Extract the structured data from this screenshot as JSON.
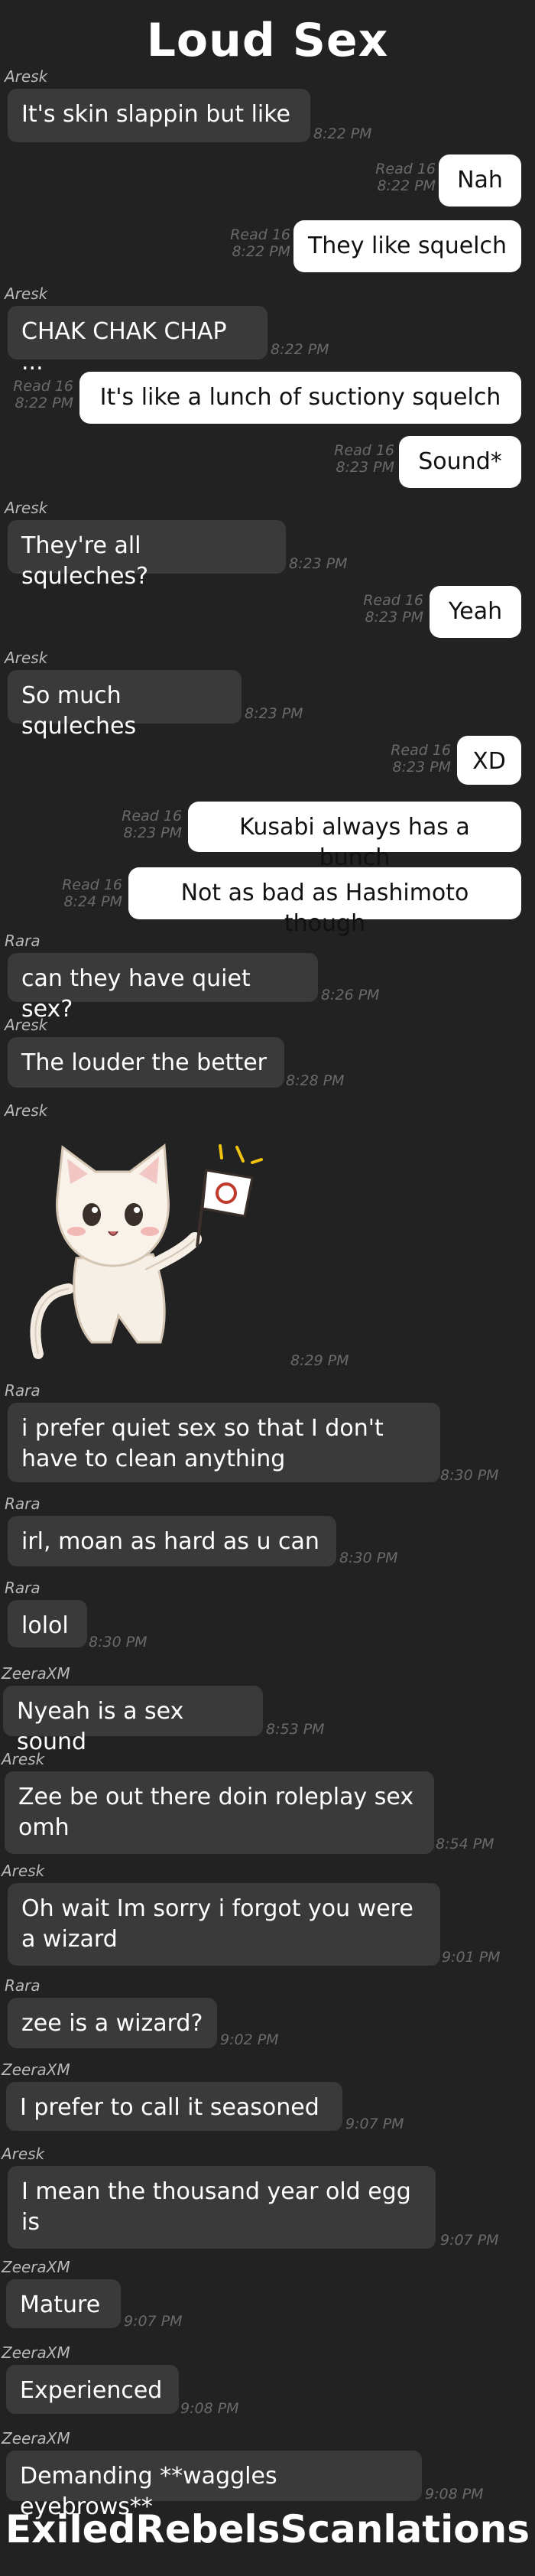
{
  "header": {
    "title": "Loud Sex"
  },
  "footer": {
    "credit": "ExiledRebelsScanlations"
  },
  "read_label": "Read 16",
  "messages": [
    {
      "sender": "Aresk",
      "text": "It's skin slappin but like",
      "time": "8:22 PM"
    },
    {
      "text": "Nah",
      "time": "8:22 PM"
    },
    {
      "text": "They like squelch",
      "time": "8:22 PM"
    },
    {
      "sender": "Aresk",
      "text": "CHAK CHAK CHAP ...",
      "time": "8:22 PM"
    },
    {
      "text": "It's like a lunch of suctiony squelch",
      "time": "8:22 PM"
    },
    {
      "text": "Sound*",
      "time": "8:23 PM"
    },
    {
      "sender": "Aresk",
      "text": "They're all squleches?",
      "time": "8:23 PM"
    },
    {
      "text": "Yeah",
      "time": "8:23 PM"
    },
    {
      "sender": "Aresk",
      "text": "So much squleches",
      "time": "8:23 PM"
    },
    {
      "text": "XD",
      "time": "8:23 PM"
    },
    {
      "text": "Kusabi always has a bunch",
      "time": "8:23 PM"
    },
    {
      "text": "Not as bad as Hashimoto though",
      "time": "8:24 PM"
    },
    {
      "sender": "Rara",
      "text": "can they have quiet sex?",
      "time": "8:26 PM"
    },
    {
      "sender": "Aresk",
      "text": "The louder the better",
      "time": "8:28 PM"
    },
    {
      "sender": "Aresk",
      "sticker": "cat-holding-flag-sticker",
      "time": "8:29 PM"
    },
    {
      "sender": "Rara",
      "text": "i prefer quiet sex so that I don't have to clean anything",
      "time": "8:30 PM"
    },
    {
      "sender": "Rara",
      "text": "irl, moan as hard as u can",
      "time": "8:30 PM"
    },
    {
      "sender": "Rara",
      "text": "lolol",
      "time": "8:30 PM"
    },
    {
      "sender": "ZeeraXM",
      "text": "Nyeah is a sex sound",
      "time": "8:53 PM"
    },
    {
      "sender": "Aresk",
      "text": "Zee be out there doin roleplay sex omh",
      "time": "8:54 PM"
    },
    {
      "sender": "Aresk",
      "text": "Oh wait Im sorry i forgot you were a wizard",
      "time": "9:01 PM"
    },
    {
      "sender": "Rara",
      "text": "zee is a wizard?",
      "time": "9:02 PM"
    },
    {
      "sender": "ZeeraXM",
      "text": "I prefer to call it seasoned",
      "time": "9:07 PM"
    },
    {
      "sender": "Aresk",
      "text": "I mean the thousand year old egg is",
      "time": "9:07 PM"
    },
    {
      "sender": "ZeeraXM",
      "text": "Mature",
      "time": "9:07 PM"
    },
    {
      "sender": "ZeeraXM",
      "text": "Experienced",
      "time": "9:08 PM"
    },
    {
      "sender": "ZeeraXM",
      "text": "Demanding **waggles eyebrows**",
      "time": "9:08 PM"
    }
  ]
}
